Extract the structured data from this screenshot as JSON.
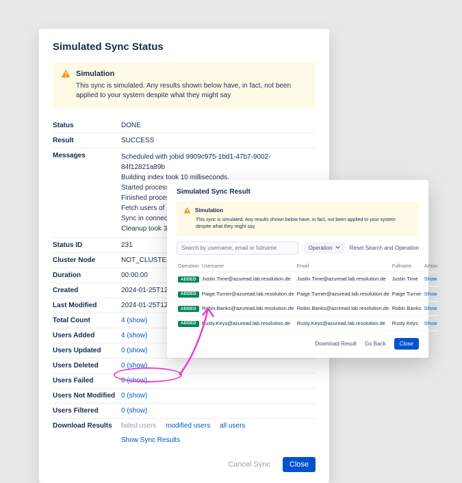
{
  "main": {
    "title": "Simulated Sync Status",
    "banner": {
      "title": "Simulation",
      "body": "This sync is simulated. Any results shown below have, in fact, not been applied to your system despite what they might say"
    },
    "rows": {
      "status_label": "Status",
      "status_value": "DONE",
      "result_label": "Result",
      "result_value": "SUCCESS",
      "messages_label": "Messages",
      "messages": [
        "Scheduled with jobid 9909c975-1bd1-47b7-9002-84f12821a89b",
        "Building index took 10 milliseconds.",
        "Started processing required groups, please wait...",
        "Finished processing 1 groups.",
        "Fetch users of 1 required groups: demo.",
        "Sync in connector took 728 milliseconds.",
        "Cleanup took 3 milliseconds."
      ],
      "status_id_label": "Status ID",
      "status_id_value": "231",
      "cluster_label": "Cluster Node",
      "cluster_value": "NOT_CLUSTERED",
      "duration_label": "Duration",
      "duration_value": "00:00:00",
      "created_label": "Created",
      "created_value": "2024-01-25T12:24:21Z",
      "modified_label": "Last Modified",
      "modified_value": "2024-01-25T12:24:22Z",
      "total_label": "Total Count",
      "total_value": "4 (show)",
      "added_label": "Users Added",
      "added_value": "4 (show)",
      "updated_label": "Users Updated",
      "updated_value": "0 (show)",
      "deleted_label": "Users Deleted",
      "deleted_value": "0 (show)",
      "failed_label": "Users Failed",
      "failed_value": "0 (show)",
      "unmod_label": "Users Not Modified",
      "unmod_value": "0 (show)",
      "filtered_label": "Users Filtered",
      "filtered_value": "0 (show)",
      "download_label": "Download Results",
      "download_failed": "failed users",
      "download_modified": "modified users",
      "download_all": "all users",
      "show_sync": "Show Sync Results"
    },
    "footer": {
      "cancel": "Cancel Sync",
      "close": "Close"
    }
  },
  "result": {
    "title": "Simulated Sync Result",
    "banner": {
      "title": "Simulation",
      "body": "This sync is simulated. Any results shown below have, in fact, not been applied to your system despite what they might say"
    },
    "search_placeholder": "Search by username, email or fullname",
    "operation_label": "Operation",
    "reset_label": "Reset Search and Operation",
    "columns": {
      "op": "Operation",
      "user": "Username",
      "email": "Email",
      "full": "Fullname",
      "action": "Action"
    },
    "badge_added": "ADDED",
    "action_show": "Show",
    "rows": [
      {
        "user": "Justin.Time@azuread.lab.resolution.de",
        "email": "Justin.Time@azuread.lab.resolution.de",
        "full": "Justin Time"
      },
      {
        "user": "Paige.Turner@azuread.lab.resolution.de",
        "email": "Paige.Turner@azuread.lab.resolution.de",
        "full": "Paige Turner"
      },
      {
        "user": "Robin.Banks@azuread.lab.resolution.de",
        "email": "Robin.Banks@azuread.lab.resolution.de",
        "full": "Robin Banks"
      },
      {
        "user": "Rusty.Keys@azuread.lab.resolution.de",
        "email": "Rusty.Keys@azuread.lab.resolution.de",
        "full": "Rusty Keys"
      }
    ],
    "footer": {
      "download": "Download Result",
      "goback": "Go Back",
      "close": "Close"
    }
  },
  "colors": {
    "accent": "#0052cc",
    "warn_bg": "#fffae6",
    "badge_green": "#00875a",
    "annotation": "#e83ccf"
  }
}
